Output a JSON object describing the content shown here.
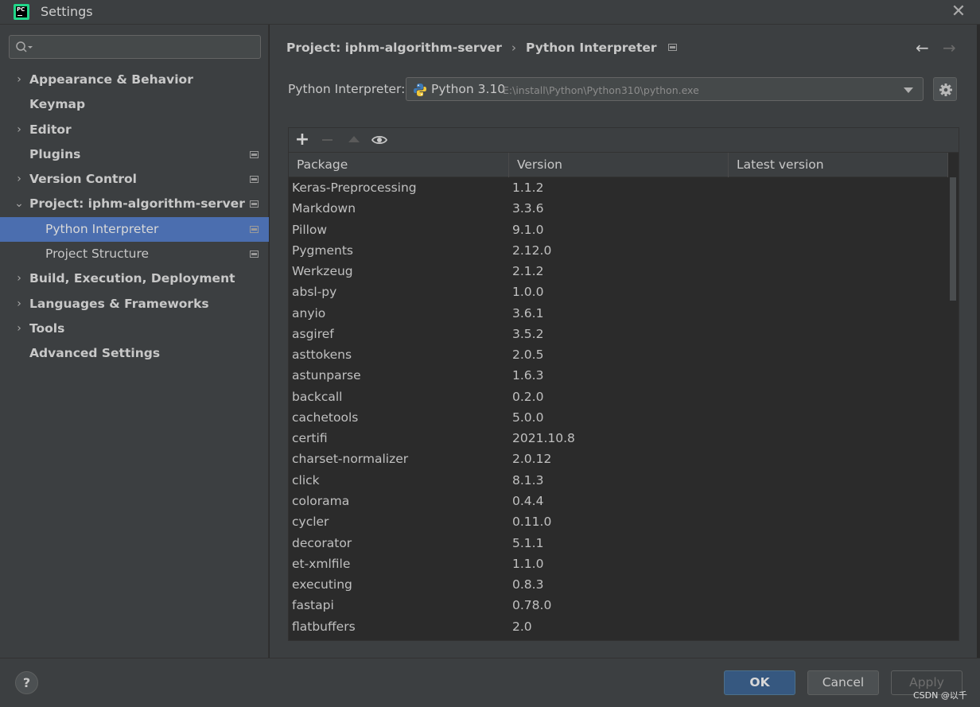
{
  "window": {
    "title": "Settings",
    "close_glyph": "✕"
  },
  "search": {
    "placeholder": ""
  },
  "sidebar": {
    "items": [
      {
        "label": "Appearance & Behavior",
        "chevron": "›",
        "sub": false,
        "selected": false,
        "project_icon": false
      },
      {
        "label": "Keymap",
        "chevron": "",
        "sub": false,
        "selected": false,
        "project_icon": false
      },
      {
        "label": "Editor",
        "chevron": "›",
        "sub": false,
        "selected": false,
        "project_icon": false
      },
      {
        "label": "Plugins",
        "chevron": "",
        "sub": false,
        "selected": false,
        "project_icon": true
      },
      {
        "label": "Version Control",
        "chevron": "›",
        "sub": false,
        "selected": false,
        "project_icon": true
      },
      {
        "label": "Project: iphm-algorithm-server",
        "chevron": "⌄",
        "sub": false,
        "selected": false,
        "project_icon": true
      },
      {
        "label": "Python Interpreter",
        "chevron": "",
        "sub": true,
        "selected": true,
        "project_icon": true
      },
      {
        "label": "Project Structure",
        "chevron": "",
        "sub": true,
        "selected": false,
        "project_icon": true
      },
      {
        "label": "Build, Execution, Deployment",
        "chevron": "›",
        "sub": false,
        "selected": false,
        "project_icon": false
      },
      {
        "label": "Languages & Frameworks",
        "chevron": "›",
        "sub": false,
        "selected": false,
        "project_icon": false
      },
      {
        "label": "Tools",
        "chevron": "›",
        "sub": false,
        "selected": false,
        "project_icon": false
      },
      {
        "label": "Advanced Settings",
        "chevron": "",
        "sub": false,
        "selected": false,
        "project_icon": false
      }
    ]
  },
  "breadcrumb": {
    "parent": "Project: iphm-algorithm-server",
    "separator": "›",
    "current": "Python Interpreter",
    "back_glyph": "←",
    "forward_glyph": "→"
  },
  "interpreter": {
    "label": "Python Interpreter:",
    "name": "Python 3.10",
    "path": "E:\\install\\Python\\Python310\\python.exe"
  },
  "toolbar": {
    "add_glyph": "+"
  },
  "table": {
    "headers": {
      "package": "Package",
      "version": "Version",
      "latest": "Latest version"
    },
    "rows": [
      {
        "package": "Keras-Preprocessing",
        "version": "1.1.2",
        "latest": ""
      },
      {
        "package": "Markdown",
        "version": "3.3.6",
        "latest": ""
      },
      {
        "package": "Pillow",
        "version": "9.1.0",
        "latest": ""
      },
      {
        "package": "Pygments",
        "version": "2.12.0",
        "latest": ""
      },
      {
        "package": "Werkzeug",
        "version": "2.1.2",
        "latest": ""
      },
      {
        "package": "absl-py",
        "version": "1.0.0",
        "latest": ""
      },
      {
        "package": "anyio",
        "version": "3.6.1",
        "latest": ""
      },
      {
        "package": "asgiref",
        "version": "3.5.2",
        "latest": ""
      },
      {
        "package": "asttokens",
        "version": "2.0.5",
        "latest": ""
      },
      {
        "package": "astunparse",
        "version": "1.6.3",
        "latest": ""
      },
      {
        "package": "backcall",
        "version": "0.2.0",
        "latest": ""
      },
      {
        "package": "cachetools",
        "version": "5.0.0",
        "latest": ""
      },
      {
        "package": "certifi",
        "version": "2021.10.8",
        "latest": ""
      },
      {
        "package": "charset-normalizer",
        "version": "2.0.12",
        "latest": ""
      },
      {
        "package": "click",
        "version": "8.1.3",
        "latest": ""
      },
      {
        "package": "colorama",
        "version": "0.4.4",
        "latest": ""
      },
      {
        "package": "cycler",
        "version": "0.11.0",
        "latest": ""
      },
      {
        "package": "decorator",
        "version": "5.1.1",
        "latest": ""
      },
      {
        "package": "et-xmlfile",
        "version": "1.1.0",
        "latest": ""
      },
      {
        "package": "executing",
        "version": "0.8.3",
        "latest": ""
      },
      {
        "package": "fastapi",
        "version": "0.78.0",
        "latest": ""
      },
      {
        "package": "flatbuffers",
        "version": "2.0",
        "latest": ""
      }
    ]
  },
  "footer": {
    "help_label": "?",
    "ok_label": "OK",
    "cancel_label": "Cancel",
    "apply_label": "Apply",
    "watermark": "CSDN @以千"
  },
  "colors": {
    "selection": "#4b6eaf",
    "panel": "#3c3f41",
    "background": "#2b2b2b",
    "ok_button": "#365880"
  },
  "icons": {
    "app_logo": "pycharm-logo-icon",
    "search": "search-icon",
    "gear": "gear-icon",
    "eye": "eye-icon",
    "python": "python-logo-icon"
  }
}
